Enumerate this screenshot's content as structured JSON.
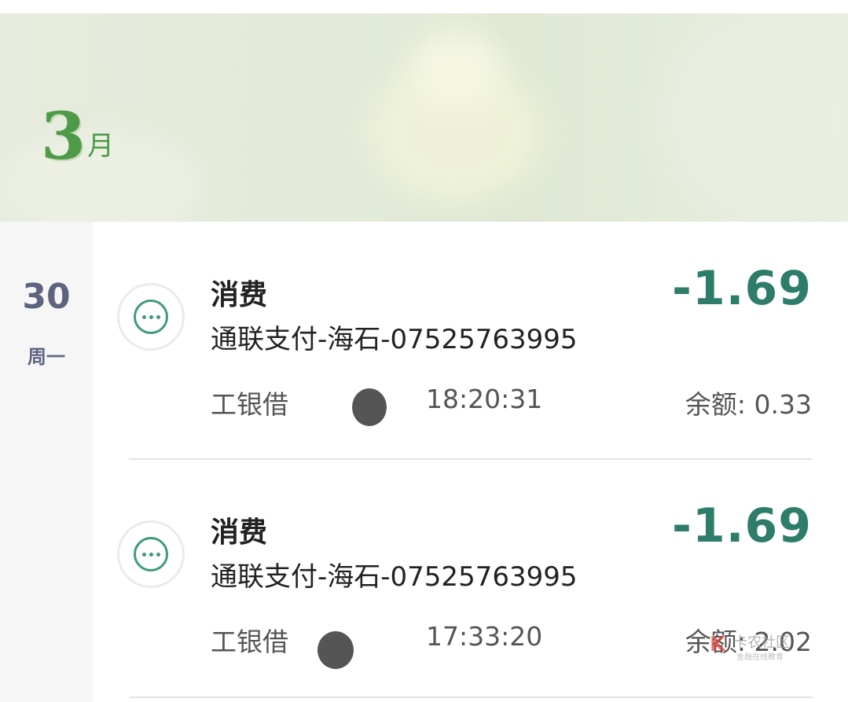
{
  "header": {
    "month_number": "3",
    "month_unit": "月"
  },
  "date": {
    "day": "30",
    "weekday": "周一"
  },
  "transactions": [
    {
      "type": "消费",
      "merchant": "通联支付-海石-07525763995",
      "amount": "-1.69",
      "card": "工银借",
      "time": "18:20:31",
      "balance": "余额: 0.33"
    },
    {
      "type": "消费",
      "merchant": "通联支付-海石-07525763995",
      "amount": "-1.69",
      "card": "工银借",
      "time": "17:33:20",
      "balance": "余额: 2.02"
    }
  ],
  "watermark": {
    "logo": "K",
    "title": "卡农社区",
    "subtitle": "金融在线教育"
  },
  "colors": {
    "accent_green": "#2e7d6b",
    "month_green": "#4e9a49",
    "date_slate": "#5e6480"
  },
  "icons": {
    "transaction_icon": "more-horizontal-circle-icon"
  }
}
